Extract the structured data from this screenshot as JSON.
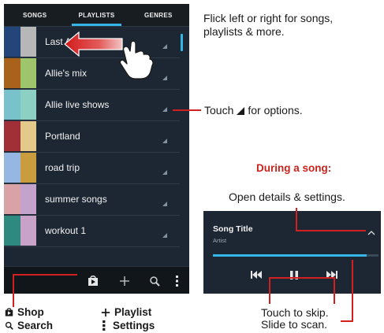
{
  "tabs": [
    {
      "label": "SONGS",
      "active": false
    },
    {
      "label": "PLAYLISTS",
      "active": true
    },
    {
      "label": "GENRES",
      "active": false
    }
  ],
  "playlists": [
    {
      "name": "Last Added",
      "colors": [
        "#24457a",
        "#b7b7b7"
      ]
    },
    {
      "name": "Allie's mix",
      "colors": [
        "#a9621b",
        "#9ec56b"
      ]
    },
    {
      "name": "Allie live shows",
      "colors": [
        "#79c1cb",
        "#8bd0c2"
      ]
    },
    {
      "name": "Portland",
      "colors": [
        "#a12f38",
        "#e4c98a"
      ]
    },
    {
      "name": "road trip",
      "colors": [
        "#95b7e2",
        "#c99c3d"
      ]
    },
    {
      "name": "summer songs",
      "colors": [
        "#d9a2a6",
        "#c3a2cc"
      ]
    },
    {
      "name": "workout 1",
      "colors": [
        "#2e8a7f",
        "#c8a2c8"
      ]
    }
  ],
  "bottom_bar": {
    "icons": [
      "shop-icon",
      "add-icon",
      "search-icon",
      "menu-icon"
    ]
  },
  "annotations": {
    "flick": [
      "Flick left or right for songs,",
      "playlists & more."
    ],
    "touch_options_prefix": "Touch",
    "touch_options_suffix": "for options.",
    "during_song": "During a song:",
    "open_details": "Open details & settings.",
    "touch_skip": "Touch to skip.",
    "slide_scan": "Slide to scan."
  },
  "legend": {
    "shop": "Shop",
    "search": "Search",
    "playlist": "Playlist",
    "settings": "Settings"
  },
  "song": {
    "title": "Song Title",
    "artist": "Artist",
    "progress": 0.93
  },
  "colors": {
    "accent": "#33b5e5",
    "highlight": "#d22020",
    "heading": "#c8241d"
  }
}
